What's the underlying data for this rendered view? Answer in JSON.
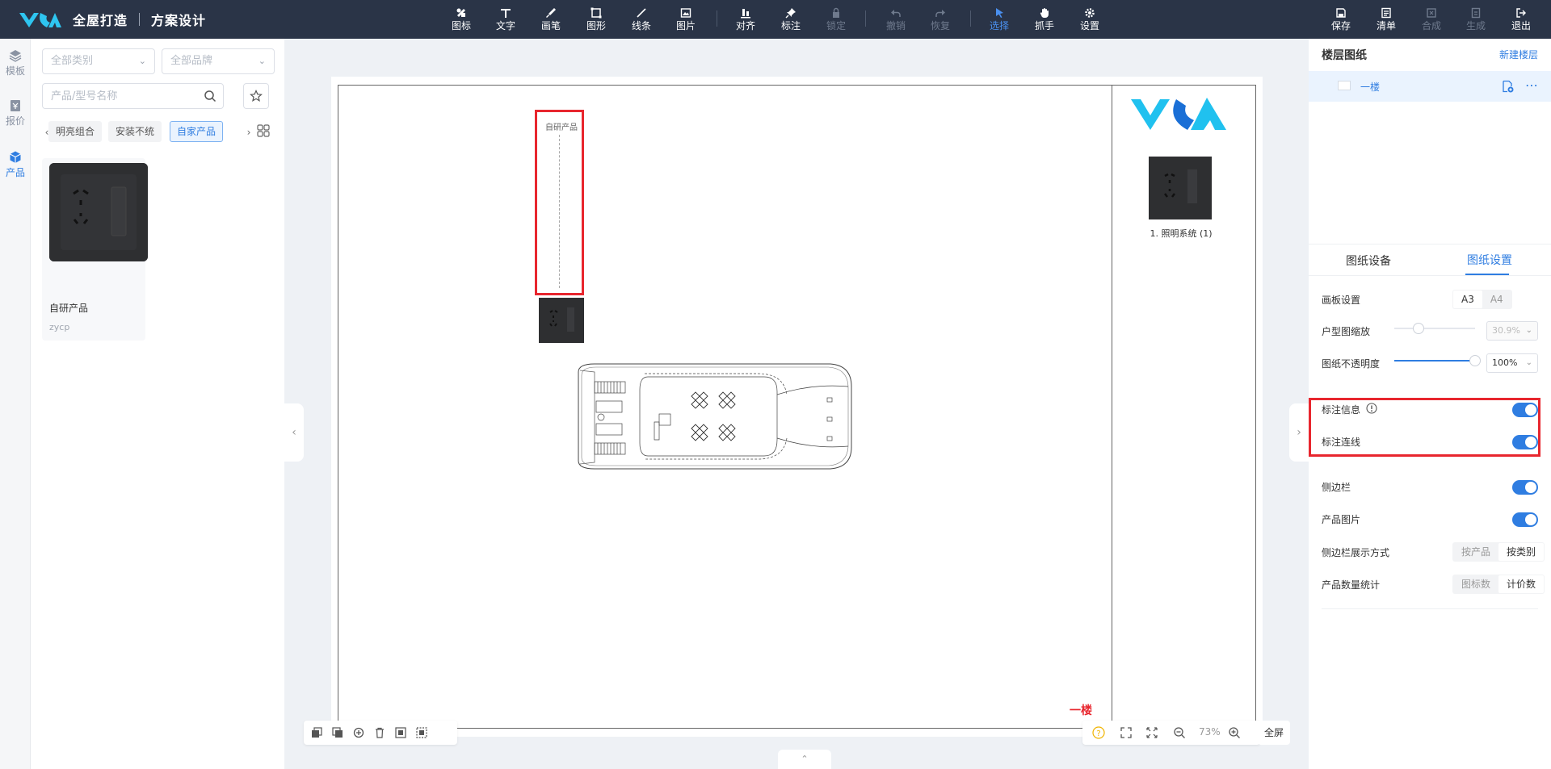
{
  "brand": {
    "name": "全屋打造",
    "subtitle": "方案设计"
  },
  "toolbar": {
    "tools": [
      {
        "label": "图标",
        "icon": "icon-tool-icon"
      },
      {
        "label": "文字",
        "icon": "text-icon"
      },
      {
        "label": "画笔",
        "icon": "brush-icon"
      },
      {
        "label": "图形",
        "icon": "shape-icon"
      },
      {
        "label": "线条",
        "icon": "line-icon"
      },
      {
        "label": "图片",
        "icon": "image-icon"
      },
      {
        "label": "对齐",
        "icon": "align-icon"
      },
      {
        "label": "标注",
        "icon": "pin-icon"
      },
      {
        "label": "锁定",
        "icon": "lock-icon",
        "state": "disabled"
      },
      {
        "label": "撤销",
        "icon": "undo-icon",
        "state": "disabled"
      },
      {
        "label": "恢复",
        "icon": "redo-icon",
        "state": "disabled"
      },
      {
        "label": "选择",
        "icon": "cursor-icon",
        "state": "active"
      },
      {
        "label": "抓手",
        "icon": "hand-icon"
      },
      {
        "label": "设置",
        "icon": "gear-icon"
      }
    ],
    "actions": [
      {
        "label": "保存",
        "icon": "save-icon"
      },
      {
        "label": "清单",
        "icon": "list-icon"
      },
      {
        "label": "合成",
        "icon": "compose-icon",
        "state": "disabled"
      },
      {
        "label": "生成",
        "icon": "generate-icon",
        "state": "disabled"
      },
      {
        "label": "退出",
        "icon": "exit-icon"
      }
    ]
  },
  "rail": {
    "items": [
      {
        "label": "模板",
        "icon": "layers-icon"
      },
      {
        "label": "报价",
        "icon": "quote-icon"
      },
      {
        "label": "产品",
        "icon": "cube-icon",
        "state": "active"
      }
    ]
  },
  "panel": {
    "category_select": "全部类别",
    "brand_select": "全部品牌",
    "search_placeholder": "产品/型号名称",
    "chips": [
      "明亮组合",
      "安装不统",
      "自家产品"
    ],
    "active_chip": "自家产品",
    "product": {
      "name": "自研产品",
      "code": "zycp"
    }
  },
  "canvas": {
    "marker_label": "自研产品",
    "floor_mark": "一楼",
    "side_caption": "1. 照明系统 (1)",
    "zoom_level": "73%",
    "fullscreen_label": "全屏"
  },
  "right_panel": {
    "title": "楼层图纸",
    "new_floor": "新建楼层",
    "floor_name": "一楼",
    "tabs": [
      "图纸设备",
      "图纸设置"
    ],
    "active_tab": "图纸设置",
    "board_label": "画板设置",
    "board_options": [
      "A3",
      "A4"
    ],
    "board_selected": "A3",
    "scale_label": "户型图缩放",
    "scale_value": "30.9%",
    "opacity_label": "图纸不透明度",
    "opacity_value": "100%",
    "opacity_level": 1.0,
    "toggles": [
      {
        "label": "标注信息",
        "on": true
      },
      {
        "label": "标注连线",
        "on": true
      },
      {
        "label": "侧边栏",
        "on": true
      },
      {
        "label": "产品图片",
        "on": true
      }
    ],
    "sidebar_mode_label": "侧边栏展示方式",
    "sidebar_mode_options": [
      "按产品",
      "按类别"
    ],
    "sidebar_mode_selected": "按类别",
    "count_label": "产品数量统计",
    "count_options": [
      "图标数",
      "计价数"
    ],
    "count_selected": "计价数"
  },
  "colors": {
    "accent": "#2f7de1",
    "topbar": "#2a3447",
    "highlight": "#e8262e"
  }
}
